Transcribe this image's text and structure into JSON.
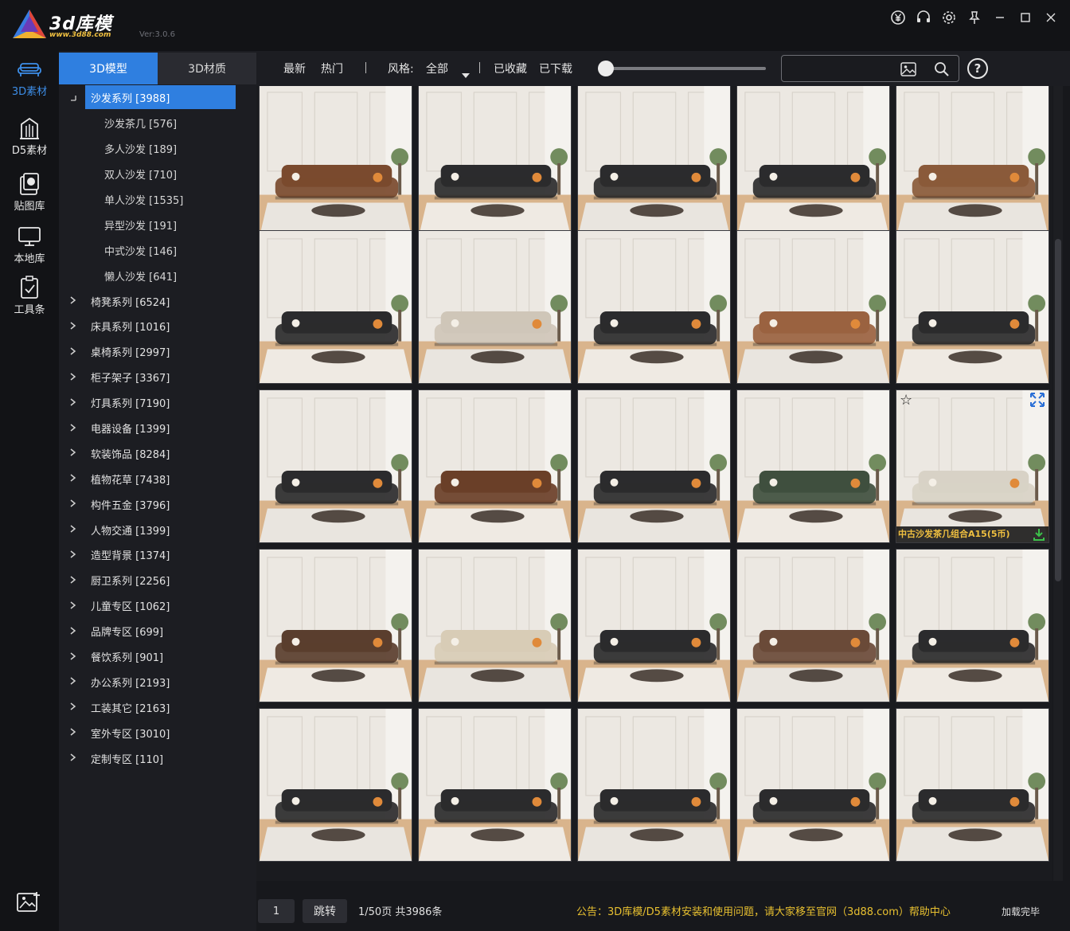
{
  "app": {
    "brand": "3d库模",
    "brand_sub": "www.3d88.com",
    "version": "Ver:3.0.6",
    "accent": "#2f7fe0"
  },
  "titlebar_icons": [
    "yen-icon",
    "headset-icon",
    "gear-icon",
    "pin-icon",
    "minimize-icon",
    "maximize-icon",
    "close-icon"
  ],
  "rail": [
    {
      "label": "3D素材",
      "icon": "sofa-icon",
      "active": true
    },
    {
      "label": "D5素材",
      "icon": "building-icon",
      "active": false
    },
    {
      "label": "贴图库",
      "icon": "image-stack-icon",
      "active": false
    },
    {
      "label": "本地库",
      "icon": "monitor-icon",
      "active": false
    },
    {
      "label": "工具条",
      "icon": "clipboard-icon",
      "active": false
    }
  ],
  "tabs": [
    {
      "label": "3D模型",
      "active": true
    },
    {
      "label": "3D材质",
      "active": false
    }
  ],
  "tree": [
    {
      "label": "沙发系列 [3988]",
      "expanded": true,
      "selected": true
    },
    {
      "label": "沙发茶几 [576]",
      "child": true
    },
    {
      "label": "多人沙发 [189]",
      "child": true
    },
    {
      "label": "双人沙发 [710]",
      "child": true
    },
    {
      "label": "单人沙发 [1535]",
      "child": true
    },
    {
      "label": "异型沙发 [191]",
      "child": true
    },
    {
      "label": "中式沙发 [146]",
      "child": true
    },
    {
      "label": "懒人沙发 [641]",
      "child": true
    },
    {
      "label": "椅凳系列 [6524]"
    },
    {
      "label": "床具系列 [1016]"
    },
    {
      "label": "桌椅系列 [2997]"
    },
    {
      "label": "柜子架子 [3367]"
    },
    {
      "label": "灯具系列 [7190]"
    },
    {
      "label": "电器设备 [1399]"
    },
    {
      "label": "软装饰品 [8284]"
    },
    {
      "label": "植物花草 [7438]"
    },
    {
      "label": "构件五金 [3796]"
    },
    {
      "label": "人物交通 [1399]"
    },
    {
      "label": "造型背景 [1374]"
    },
    {
      "label": "厨卫系列 [2256]"
    },
    {
      "label": "儿童专区 [1062]"
    },
    {
      "label": "品牌专区 [699]"
    },
    {
      "label": "餐饮系列 [901]"
    },
    {
      "label": "办公系列 [2193]"
    },
    {
      "label": "工装其它 [2163]"
    },
    {
      "label": "室外专区 [3010]"
    },
    {
      "label": "定制专区 [110]"
    }
  ],
  "toolbar": {
    "latest": "最新",
    "hot": "热门",
    "style_label": "风格:",
    "style_value": "全部",
    "favorited": "已收藏",
    "downloaded": "已下载",
    "search_placeholder": "",
    "help": "?"
  },
  "grid": {
    "hover_caption": "中古沙发茶几组合A15(5币)",
    "items": [
      {
        "sofa": "#7a4a2e",
        "tone": "warm"
      },
      {
        "sofa": "#2b2b2d",
        "tone": "light"
      },
      {
        "sofa": "#2b2b2d",
        "tone": "light"
      },
      {
        "sofa": "#2b2b2d",
        "tone": "light"
      },
      {
        "sofa": "#8a5a3a",
        "tone": "warm"
      },
      {
        "sofa": "#2b2b2d",
        "tone": "light"
      },
      {
        "sofa": "#cfc6b8",
        "tone": "light"
      },
      {
        "sofa": "#2b2b2d",
        "tone": "light"
      },
      {
        "sofa": "#9a6240",
        "tone": "light"
      },
      {
        "sofa": "#2b2b2d",
        "tone": "light"
      },
      {
        "sofa": "#2b2b2d",
        "tone": "light"
      },
      {
        "sofa": "#6a3f28",
        "tone": "light"
      },
      {
        "sofa": "#2b2b2d",
        "tone": "light"
      },
      {
        "sofa": "#3f4f3e",
        "tone": "light"
      },
      {
        "sofa": "#d8d2c6",
        "tone": "light",
        "hover": true
      },
      {
        "sofa": "#5a3e2e",
        "tone": "light"
      },
      {
        "sofa": "#d8ccb6",
        "tone": "light"
      },
      {
        "sofa": "#2b2b2d",
        "tone": "light"
      },
      {
        "sofa": "#6a4a38",
        "tone": "light"
      },
      {
        "sofa": "#2b2b2d",
        "tone": "light"
      },
      {
        "sofa": "#2b2b2d",
        "tone": "light"
      },
      {
        "sofa": "#2b2b2d",
        "tone": "light"
      },
      {
        "sofa": "#2b2b2d",
        "tone": "light"
      },
      {
        "sofa": "#2b2b2d",
        "tone": "light"
      },
      {
        "sofa": "#2b2b2d",
        "tone": "light"
      }
    ]
  },
  "pager": {
    "page_input": "1",
    "jump_label": "跳转",
    "page_info": "1/50页 共3986条",
    "notice": "公告：3D库模/D5素材安装和使用问题，请大家移至官网（3d88.com）帮助中心",
    "status": "加载完毕"
  }
}
